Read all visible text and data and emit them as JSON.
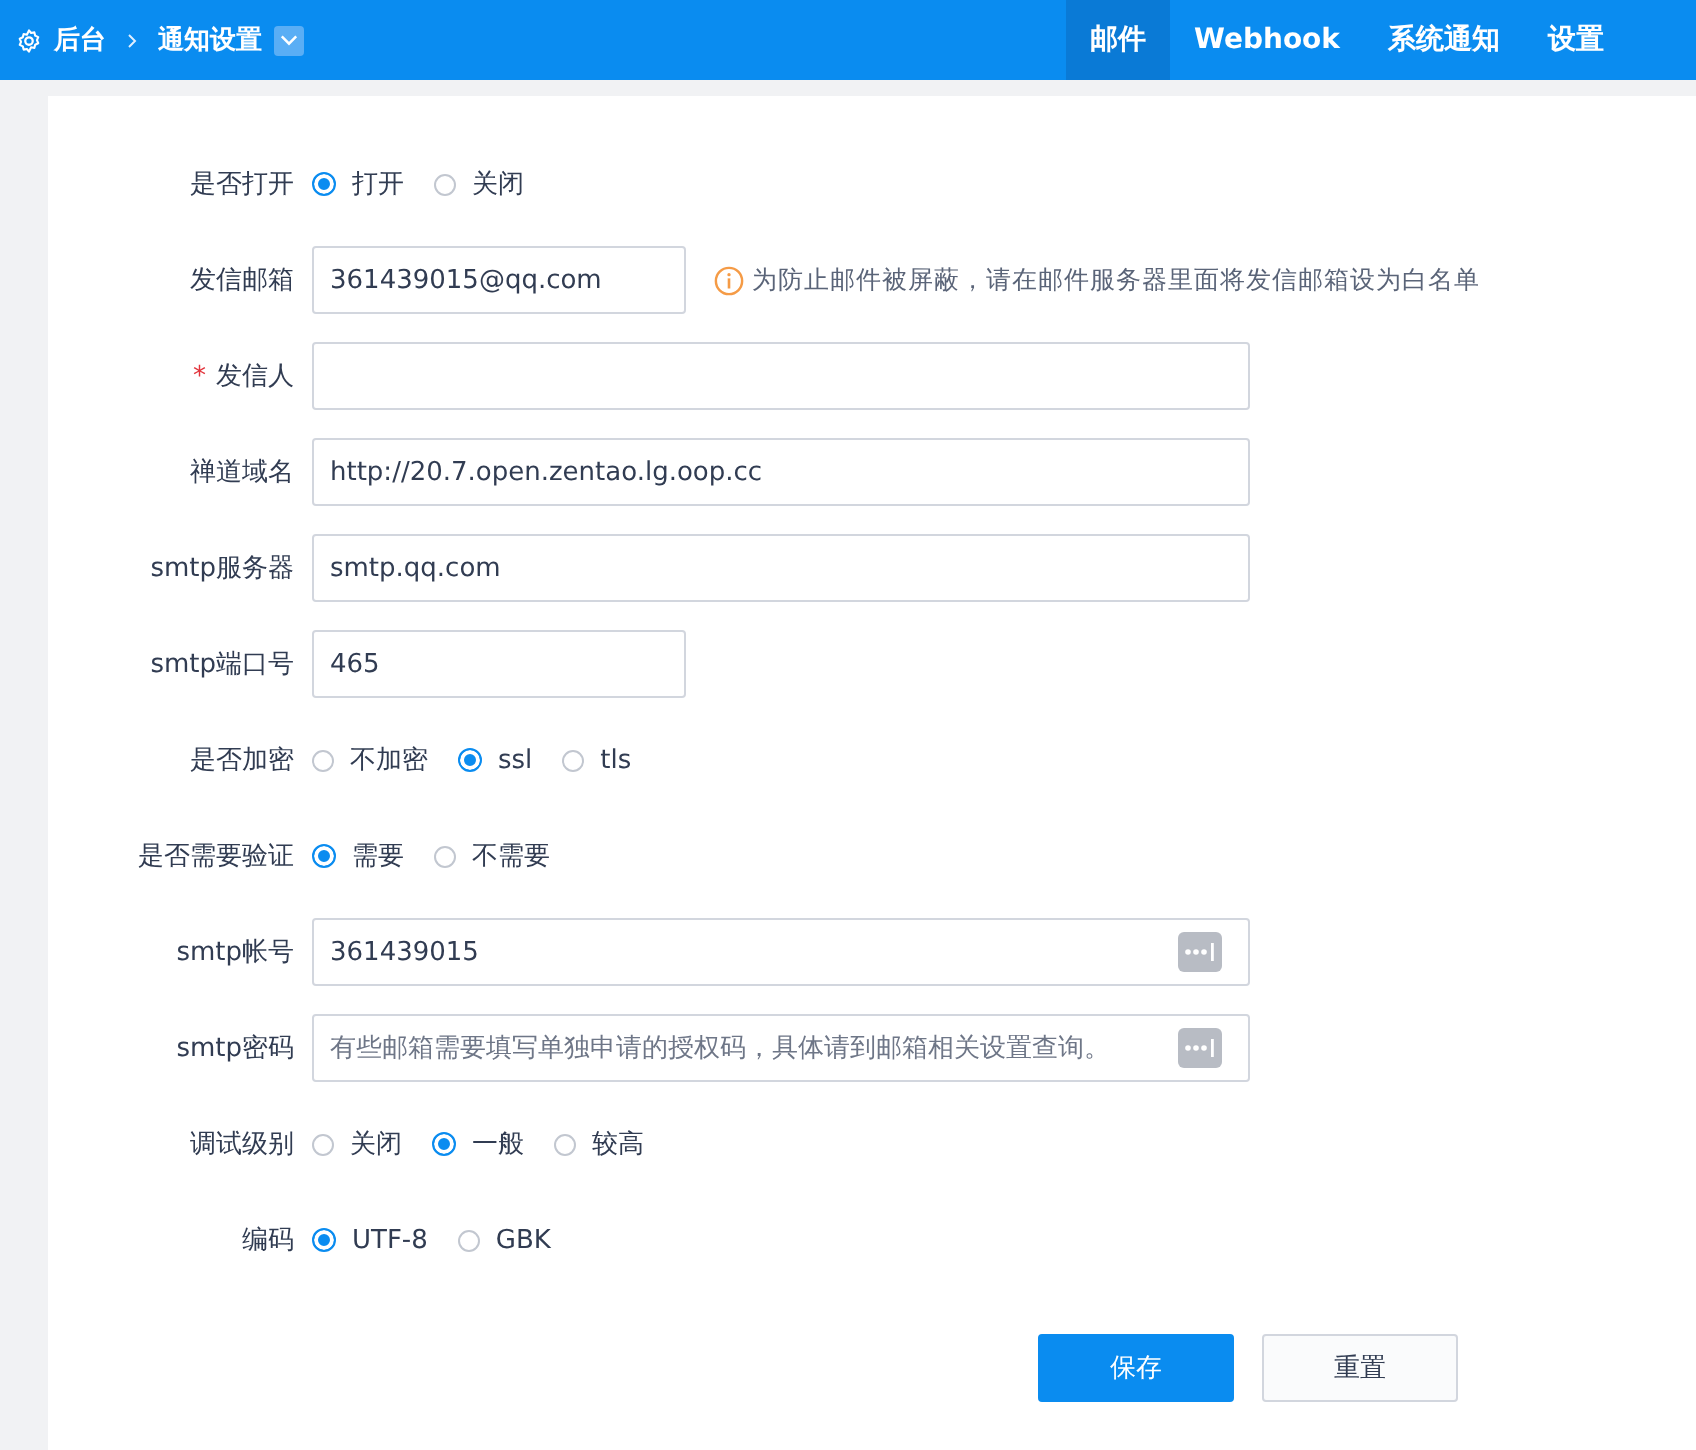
{
  "header": {
    "breadcrumb": [
      {
        "label": "后台"
      },
      {
        "label": "通知设置"
      }
    ],
    "tabs": [
      {
        "label": "邮件",
        "selected": true
      },
      {
        "label": "Webhook",
        "selected": false
      },
      {
        "label": "系统通知",
        "selected": false
      },
      {
        "label": "设置",
        "selected": false
      }
    ]
  },
  "form": {
    "fields": [
      {
        "kind": "radio",
        "label": "是否打开",
        "options": [
          {
            "label": "打开",
            "selected": true
          },
          {
            "label": "关闭",
            "selected": false
          }
        ]
      },
      {
        "kind": "text",
        "label": "发信邮箱",
        "value": "361439015@qq.com",
        "hint": "为防止邮件被屏蔽，请在邮件服务器里面将发信邮箱设为白名单"
      },
      {
        "kind": "text",
        "label": "发信人",
        "required_mark": "*"
      },
      {
        "kind": "text",
        "label": "禅道域名",
        "value": "http://20.7.open.zentao.lg.oop.cc"
      },
      {
        "kind": "text",
        "label": "smtp服务器",
        "value": "smtp.qq.com"
      },
      {
        "kind": "text",
        "label": "smtp端口号",
        "value": "465"
      },
      {
        "kind": "radio",
        "label": "是否加密",
        "options": [
          {
            "label": "不加密",
            "selected": false
          },
          {
            "label": "ssl",
            "selected": true
          },
          {
            "label": "tls",
            "selected": false
          }
        ]
      },
      {
        "kind": "radio",
        "label": "是否需要验证",
        "options": [
          {
            "label": "需要",
            "selected": true
          },
          {
            "label": "不需要",
            "selected": false
          }
        ]
      },
      {
        "kind": "secret",
        "label": "smtp帐号",
        "value": "361439015"
      },
      {
        "kind": "secret",
        "label": "smtp密码",
        "placeholder": "有些邮箱需要填写单独申请的授权码，具体请到邮箱相关设置查询。"
      },
      {
        "kind": "radio",
        "label": "调试级别",
        "options": [
          {
            "label": "关闭",
            "selected": false
          },
          {
            "label": "一般",
            "selected": true
          },
          {
            "label": "较高",
            "selected": false
          }
        ]
      },
      {
        "kind": "radio",
        "label": "编码",
        "options": [
          {
            "label": "UTF-8",
            "selected": true
          },
          {
            "label": "GBK",
            "selected": false
          }
        ]
      }
    ],
    "buttons": [
      {
        "label": "保存",
        "kind": "primary"
      },
      {
        "label": "重置",
        "kind": "default"
      }
    ]
  }
}
